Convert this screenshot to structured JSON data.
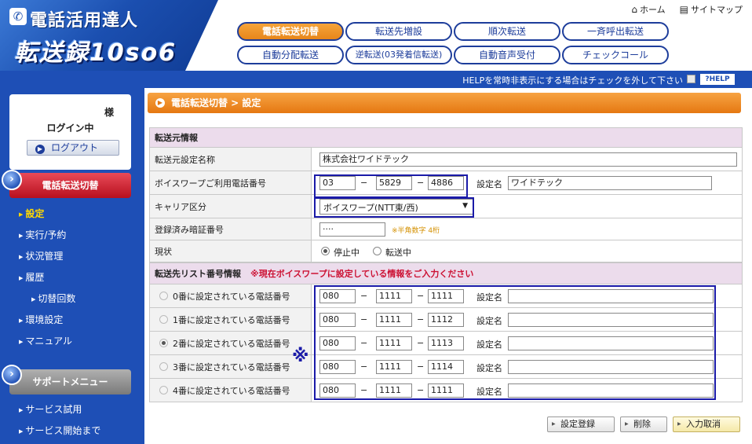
{
  "header": {
    "app_name": "電話活用達人",
    "product_name": "転送録10so6",
    "links": [
      {
        "icon": "home-icon",
        "label": "ホーム"
      },
      {
        "icon": "sitemap-icon",
        "label": "サイトマップ"
      }
    ],
    "tabs": [
      {
        "label": "電話転送切替",
        "active": true
      },
      {
        "label": "転送先増設"
      },
      {
        "label": "順次転送"
      },
      {
        "label": "一斉呼出転送"
      },
      {
        "label": "自動分配転送"
      },
      {
        "label": "逆転送(03発着信転送)"
      },
      {
        "label": "自動音声受付"
      },
      {
        "label": "チェックコール"
      }
    ]
  },
  "help_bar": {
    "text": "HELPを常時非表示にする場合はチェックを外して下さい",
    "button": "?HELP"
  },
  "sidebar": {
    "login": {
      "sama": "様",
      "status": "ログイン中",
      "logout": "ログアウト"
    },
    "section1": {
      "title": "電話転送切替",
      "items": [
        "設定",
        "実行/予約",
        "状況管理",
        "履歴",
        "切替回数",
        "環境設定",
        "マニュアル"
      ]
    },
    "section2": {
      "title": "サポートメニュー",
      "items": [
        "サービス試用",
        "サービス開始まで"
      ]
    }
  },
  "main": {
    "breadcrumb": "電話転送切替 > 設定",
    "source_section": "転送元情報",
    "fields": {
      "setting_name_label": "転送元設定名称",
      "setting_name_value": "株式会社ワイドテック",
      "phone_label": "ボイスワープご利用電話番号",
      "phone": [
        "03",
        "5829",
        "4886"
      ],
      "phone_setting_name_label": "設定名",
      "phone_setting_name_value": "ワイドテック",
      "carrier_label": "キャリア区分",
      "carrier_value": "ボイスワープ(NTT東/西)",
      "pin_label": "登録済み暗証番号",
      "pin_value": "····",
      "pin_hint": "※半角数字 4桁",
      "status_label": "現状",
      "status_options": [
        "停止中",
        "転送中"
      ],
      "status_selected": "停止中"
    },
    "dest_section": "転送先リスト番号情報",
    "dest_note": "※現在ボイスワープに設定している情報をご入力ください",
    "setting_name_label": "設定名",
    "destinations": [
      {
        "label": "0番に設定されている電話番号",
        "phone": [
          "080",
          "1111",
          "1111"
        ],
        "name": "",
        "selected": false
      },
      {
        "label": "1番に設定されている電話番号",
        "phone": [
          "080",
          "1111",
          "1112"
        ],
        "name": "",
        "selected": false
      },
      {
        "label": "2番に設定されている電話番号",
        "phone": [
          "080",
          "1111",
          "1113"
        ],
        "name": "",
        "selected": true
      },
      {
        "label": "3番に設定されている電話番号",
        "phone": [
          "080",
          "1111",
          "1114"
        ],
        "name": "",
        "selected": false
      },
      {
        "label": "4番に設定されている電話番号",
        "phone": [
          "080",
          "1111",
          "1111"
        ],
        "name": "",
        "selected": false
      }
    ],
    "marker": "※",
    "buttons": {
      "register": "設定登録",
      "delete": "削除",
      "cancel": "入力取消"
    }
  },
  "colors": {
    "brand_blue": "#1e4fb6",
    "active_tab": "#e7861a",
    "section_red": "#b8101e",
    "highlight": "#1a1aa8"
  }
}
